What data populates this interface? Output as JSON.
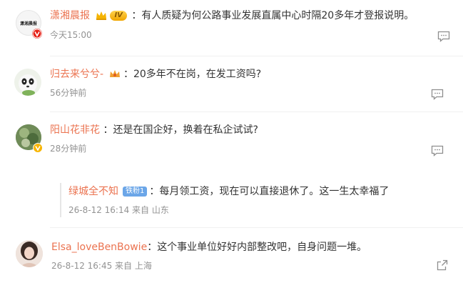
{
  "comments": [
    {
      "user": "潇湘晨报",
      "level_badge": "IV",
      "text": "有人质疑为何公路事业发展直属中心时隔20多年才登报说明。",
      "time": "今天15:00",
      "avatar_label": "潇湘晨报"
    },
    {
      "user": "归去来兮兮-",
      "text": "20多年不在岗，在发工资吗?",
      "time": "56分钟前"
    },
    {
      "user": "阳山花非花",
      "text": "还是在国企好，换着在私企试试?",
      "time": "28分钟前"
    },
    {
      "user": "绿城全不知",
      "fan_badge": "铁粉1",
      "text": "每月领工资，现在可以直接退休了。这一生太幸福了",
      "time": "26-8-12 16:14 来自 山东"
    },
    {
      "user": "Elsa_loveBenBowie",
      "text": "这个事业单位好好内部整改吧，自身问题一堆。",
      "time": "26-8-12 16:45 来自 上海"
    }
  ],
  "separator": "：",
  "icons": {
    "reply": "comment-bubble-icon",
    "share": "share-icon",
    "verified_red": "verified-v-icon",
    "verified_gold": "verified-v-gold-icon",
    "vip_crown": "crown-icon"
  },
  "colors": {
    "username": "#eb7350",
    "meta": "#939393",
    "text": "#333333"
  }
}
